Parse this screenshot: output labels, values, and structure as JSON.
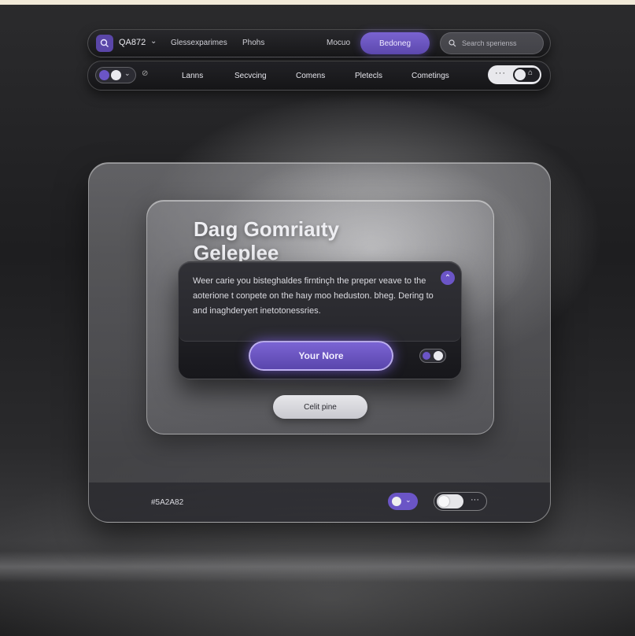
{
  "topbar": {
    "app_title": "QA872",
    "links": [
      "Glessexparimes",
      "Phohs",
      "Mocuo"
    ],
    "primary_button": "Bedoneg",
    "search_placeholder": "Search sperienss"
  },
  "tabbar": {
    "tabs": [
      "Lanns",
      "Secvcing",
      "Comens",
      "Pletecls",
      "Cometings"
    ]
  },
  "panel": {
    "heading_line1": "Daıg Gomriaıty",
    "heading_line2": "Geleplee",
    "body_text": "Weer carie you bisteghaldes firntinçh the preper veave to the aoterione t conpete on the haıy moo heduston. bheg. Dering to and inaghderyert inetotonessries.",
    "cta_label": "Your Nore",
    "secondary_label": "Celit pine"
  },
  "footer": {
    "hex_value": "#5A2A82"
  },
  "colors": {
    "accent": "#6b55c6",
    "accent_dark": "#5a46ac"
  }
}
